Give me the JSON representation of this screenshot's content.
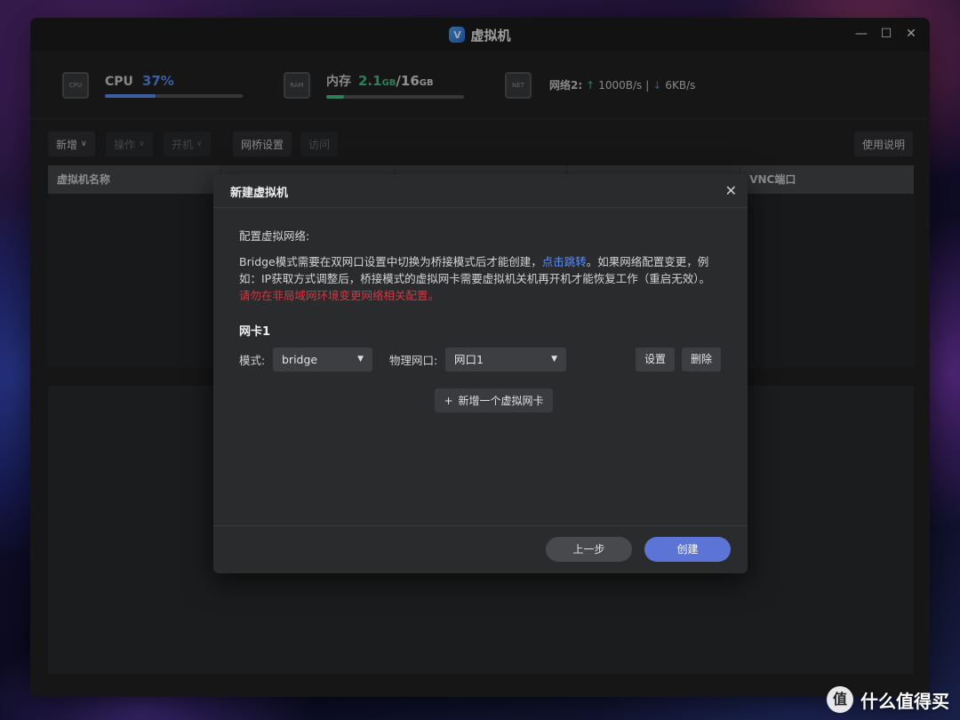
{
  "window": {
    "title": "虚拟机",
    "app_icon": "V",
    "controls": [
      "—",
      "☐",
      "✕"
    ]
  },
  "stats": {
    "cpu": {
      "label": "CPU",
      "value": "37%",
      "usage_percent": 37,
      "color": "#5b8ff9",
      "chip": "CPU"
    },
    "memory": {
      "label": "内存",
      "used": "2.1",
      "used_unit": "GB",
      "sep": "/",
      "total": "16",
      "total_unit": "GB",
      "usage_fraction": 0.13,
      "color": "#3ec48a",
      "chip": "RAM"
    },
    "network": {
      "label": "网络2:",
      "up": "1000B/s",
      "sep": "|",
      "down": "6KB/s",
      "chip": "NET",
      "up_arrow": "↑",
      "down_arrow": "↓"
    }
  },
  "toolbar": {
    "new": "新增",
    "ops": "操作",
    "power": "开机",
    "bridge": "网桥设置",
    "access": "访问",
    "help": "使用说明",
    "chevron": "∨"
  },
  "table": {
    "columns": [
      "虚拟机名称",
      "",
      "",
      "",
      "VNC端口"
    ]
  },
  "modal": {
    "title": "新建虚拟机",
    "close": "✕",
    "section": "配置虚拟网络:",
    "desc_part1": "Bridge模式需要在双网口设置中切换为桥接模式后才能创建，",
    "desc_link": "点击跳转",
    "desc_part2": "。如果网络配置变更，例如：IP获取方式调整后，桥接模式的虚拟网卡需要虚拟机关机再开机才能恢复工作（重启无效）。",
    "warning": "请勿在非局域网环境变更网络相关配置。",
    "nic": {
      "title": "网卡1",
      "mode_label": "模式:",
      "mode_value": "bridge",
      "port_label": "物理网口:",
      "port_value": "网口1",
      "settings": "设置",
      "delete": "删除"
    },
    "add_nic": "新增一个虚拟网卡",
    "add_icon": "+",
    "prev": "上一步",
    "create": "创建"
  },
  "watermark": {
    "logo": "值",
    "text": "什么值得买"
  }
}
